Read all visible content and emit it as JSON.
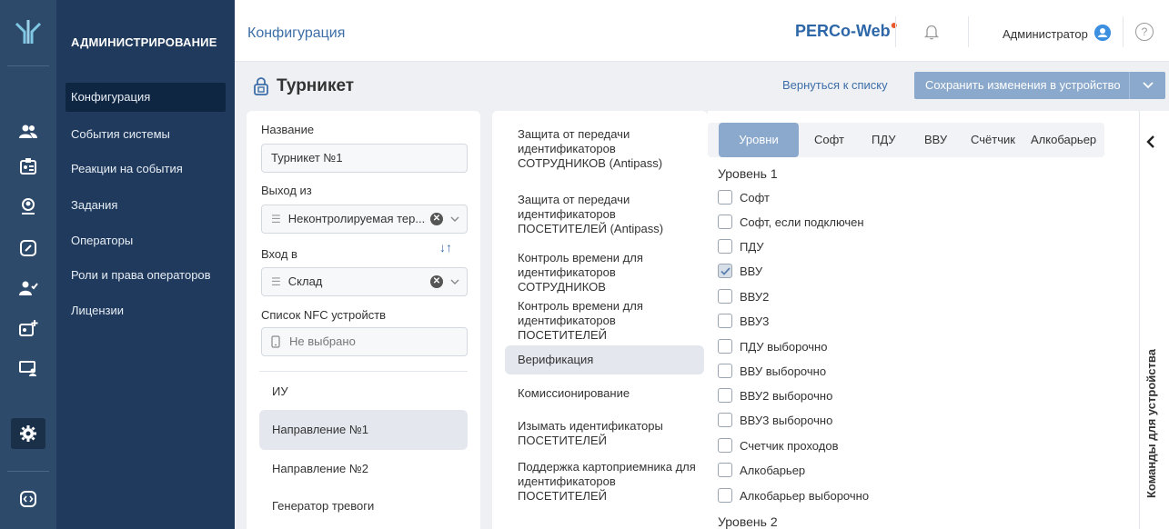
{
  "colors": {
    "rail_bg": "#2d4a6b",
    "sidebar_bg": "#1f3a5c",
    "accent": "#3d6ea8",
    "primary_button": "#8ba9cc",
    "brand_dot": "#e85a2e"
  },
  "rail": {
    "icons": [
      "logo-icon",
      "users-icon",
      "id-card-icon",
      "visitor-icon",
      "link-icon",
      "user-check-icon",
      "id-card-plus-icon",
      "monitor-user-icon",
      "gear-icon",
      "code-icon"
    ]
  },
  "sidebar": {
    "heading": "АДМИНИСТРИРОВАНИЕ",
    "items": [
      {
        "label": "Конфигурация",
        "active": true
      },
      {
        "label": "События системы"
      },
      {
        "label": "Реакции на события"
      },
      {
        "label": "Задания"
      },
      {
        "label": "Операторы"
      },
      {
        "label": "Роли и права операторов"
      },
      {
        "label": "Лицензии"
      }
    ]
  },
  "header": {
    "title": "Конфигурация",
    "brand": "PERCo-Web",
    "brand_dot": "●",
    "user": "Администратор",
    "help": "?"
  },
  "page": {
    "title": "Турникет",
    "back_link": "Вернуться к списку",
    "save_button": "Сохранить изменения в устройство"
  },
  "form": {
    "name_label": "Название",
    "name_value": "Турникет №1",
    "exit_label": "Выход из",
    "exit_value": "Неконтролируемая тер...",
    "entry_label": "Вход в",
    "entry_value": "Склад",
    "nfc_label": "Список NFC устройств",
    "nfc_placeholder": "Не выбрано"
  },
  "device_nav": [
    {
      "label": "ИУ"
    },
    {
      "label": "Направление №1",
      "active": true
    },
    {
      "label": "Направление №2"
    },
    {
      "label": "Генератор тревоги"
    }
  ],
  "settings_list": [
    {
      "label": "Защита от передачи идентификаторов СОТРУДНИКОВ (Antipass)"
    },
    {
      "label": "Защита от передачи идентификаторов ПОСЕТИТЕЛЕЙ (Antipass)"
    },
    {
      "label": "Контроль времени для идентификаторов СОТРУДНИКОВ"
    },
    {
      "label": "Контроль времени для идентификаторов ПОСЕТИТЕЛЕЙ"
    },
    {
      "label": "Верификация",
      "active": true
    },
    {
      "label": "Комиссионирование"
    },
    {
      "label": "Изымать идентификаторы ПОСЕТИТЕЛЕЙ"
    },
    {
      "label": "Поддержка картоприемника для идентификаторов ПОСЕТИТЕЛЕЙ"
    }
  ],
  "tabs": [
    {
      "label": "Уровни",
      "active": true
    },
    {
      "label": "Софт"
    },
    {
      "label": "ПДУ"
    },
    {
      "label": "ВВУ"
    },
    {
      "label": "Счётчик"
    },
    {
      "label": "Алкобарьер"
    }
  ],
  "level1": {
    "heading": "Уровень 1",
    "options": [
      {
        "label": "Софт",
        "checked": false
      },
      {
        "label": "Софт, если подключен",
        "checked": false
      },
      {
        "label": "ПДУ",
        "checked": false
      },
      {
        "label": "ВВУ",
        "checked": true
      },
      {
        "label": "ВВУ2",
        "checked": false
      },
      {
        "label": "ВВУ3",
        "checked": false
      },
      {
        "label": "ПДУ выборочно",
        "checked": false
      },
      {
        "label": "ВВУ выборочно",
        "checked": false
      },
      {
        "label": "ВВУ2 выборочно",
        "checked": false
      },
      {
        "label": "ВВУ3 выборочно",
        "checked": false
      },
      {
        "label": "Счетчик проходов",
        "checked": false
      },
      {
        "label": "Алкобарьер",
        "checked": false
      },
      {
        "label": "Алкобарьер выборочно",
        "checked": false
      }
    ]
  },
  "level2": {
    "heading": "Уровень 2"
  },
  "commands": {
    "label": "Команды для устройства"
  }
}
